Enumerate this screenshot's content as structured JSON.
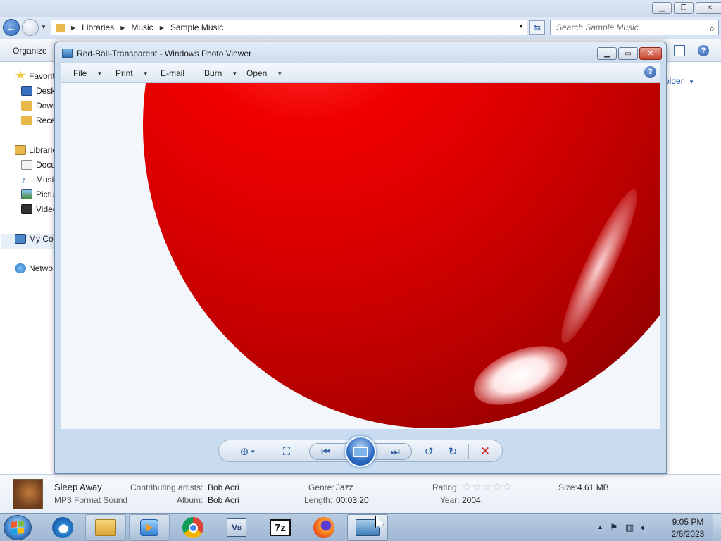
{
  "explorer": {
    "breadcrumbs": [
      "Libraries",
      "Music",
      "Sample Music"
    ],
    "search_placeholder": "Search Sample Music",
    "toolbar": {
      "organize_label": "Organize"
    },
    "sidebar": {
      "items": [
        {
          "label": "Favorit",
          "icon": "star-icon"
        },
        {
          "label": "Deskt",
          "icon": "desktop-icon"
        },
        {
          "label": "Down",
          "icon": "downloads-icon"
        },
        {
          "label": "Rece",
          "icon": "recent-places-icon"
        },
        {
          "label": "Librarie",
          "icon": "libraries-icon"
        },
        {
          "label": "Docu",
          "icon": "documents-icon"
        },
        {
          "label": "Musi",
          "icon": "music-icon"
        },
        {
          "label": "Pictu",
          "icon": "pictures-icon"
        },
        {
          "label": "Video",
          "icon": "videos-icon"
        },
        {
          "label": "My Co",
          "icon": "computer-icon"
        },
        {
          "label": "Netwo",
          "icon": "network-icon"
        }
      ],
      "selected": "Musi"
    },
    "right_panel_text": "older",
    "details": {
      "title": "Sleep Away",
      "type": "MP3 Format Sound",
      "contributing_artists_label": "Contributing artists:",
      "contributing_artists": "Bob Acri",
      "album_label": "Album:",
      "album": "Bob Acri",
      "genre_label": "Genre:",
      "genre": "Jazz",
      "length_label": "Length:",
      "length": "00:03:20",
      "rating_label": "Rating:",
      "rating_stars": 0,
      "year_label": "Year:",
      "year": "2004",
      "size_label": "Size:",
      "size": "4.61 MB"
    }
  },
  "photo_viewer": {
    "title": "Red-Ball-Transparent - Windows Photo Viewer",
    "menu": [
      {
        "label": "File",
        "has_dropdown": true
      },
      {
        "label": "Print",
        "has_dropdown": true
      },
      {
        "label": "E-mail",
        "has_dropdown": false
      },
      {
        "label": "Burn",
        "has_dropdown": true
      },
      {
        "label": "Open",
        "has_dropdown": true
      }
    ],
    "controls": [
      "zoom-icon",
      "actual-size-icon",
      "previous-icon",
      "slideshow-icon",
      "next-icon",
      "rotate-counterclockwise-icon",
      "rotate-clockwise-icon",
      "delete-icon"
    ],
    "accent_colors": {
      "ball": "#e00000",
      "delete": "#d02020"
    }
  },
  "taskbar": {
    "pinned": [
      "internet-explorer-icon",
      "windows-explorer-icon",
      "windows-media-player-icon",
      "chrome-icon",
      "virtualbox-icon",
      "7zip-icon",
      "firefox-icon",
      "photo-viewer-icon"
    ],
    "active": "photo-viewer-icon",
    "clock_time": "9:05 PM",
    "clock_date": "2/6/2023"
  }
}
